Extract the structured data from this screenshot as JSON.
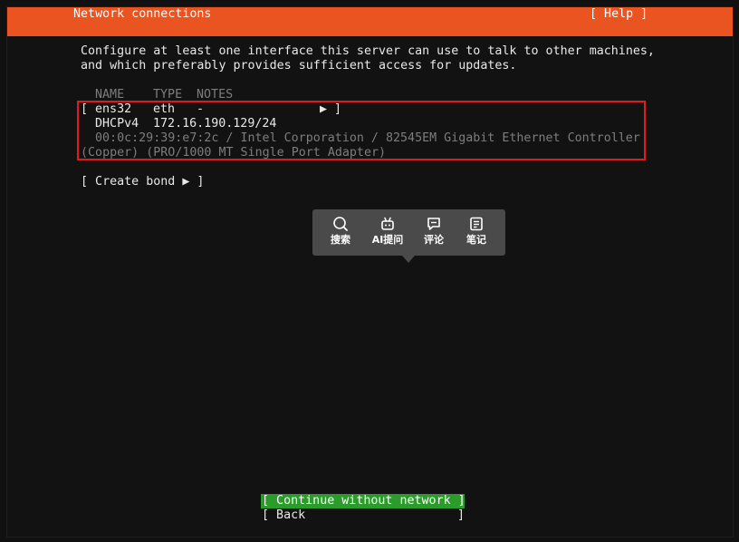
{
  "header": {
    "title": "Network connections",
    "help": "[ Help ]"
  },
  "intro": {
    "line1": "Configure at least one interface this server can use to talk to other machines,",
    "line2": "and which preferably provides sufficient access for updates."
  },
  "table": {
    "columns": [
      "NAME",
      "TYPE",
      "NOTES"
    ],
    "interface": {
      "open_bracket": "[",
      "name": "ens32",
      "type": "eth",
      "notes": "-",
      "arrow": "▶",
      "close_bracket": "]",
      "dhcp_label": "DHCPv4",
      "address": "172.16.190.129/24",
      "hw_line1": "00:0c:29:39:e7:2c / Intel Corporation / 82545EM Gigabit Ethernet Controller",
      "hw_line2": "(Copper) (PRO/1000 MT Single Port Adapter)"
    }
  },
  "create_bond": "[ Create bond ▶ ]",
  "popup": {
    "items": [
      {
        "icon": "search-icon",
        "label": "搜索"
      },
      {
        "icon": "ai-robot-icon",
        "label": "AI提问"
      },
      {
        "icon": "comment-icon",
        "label": "评论"
      },
      {
        "icon": "note-icon",
        "label": "笔记"
      }
    ]
  },
  "footer": {
    "continue": "[ Continue without network ]",
    "back_open": "[ Back",
    "back_close": "]"
  },
  "colors": {
    "header_bg": "#e95420",
    "selected_border": "#e01b1b",
    "primary_button_bg": "#2b9b2b",
    "popup_bg": "#4a4a4a"
  }
}
